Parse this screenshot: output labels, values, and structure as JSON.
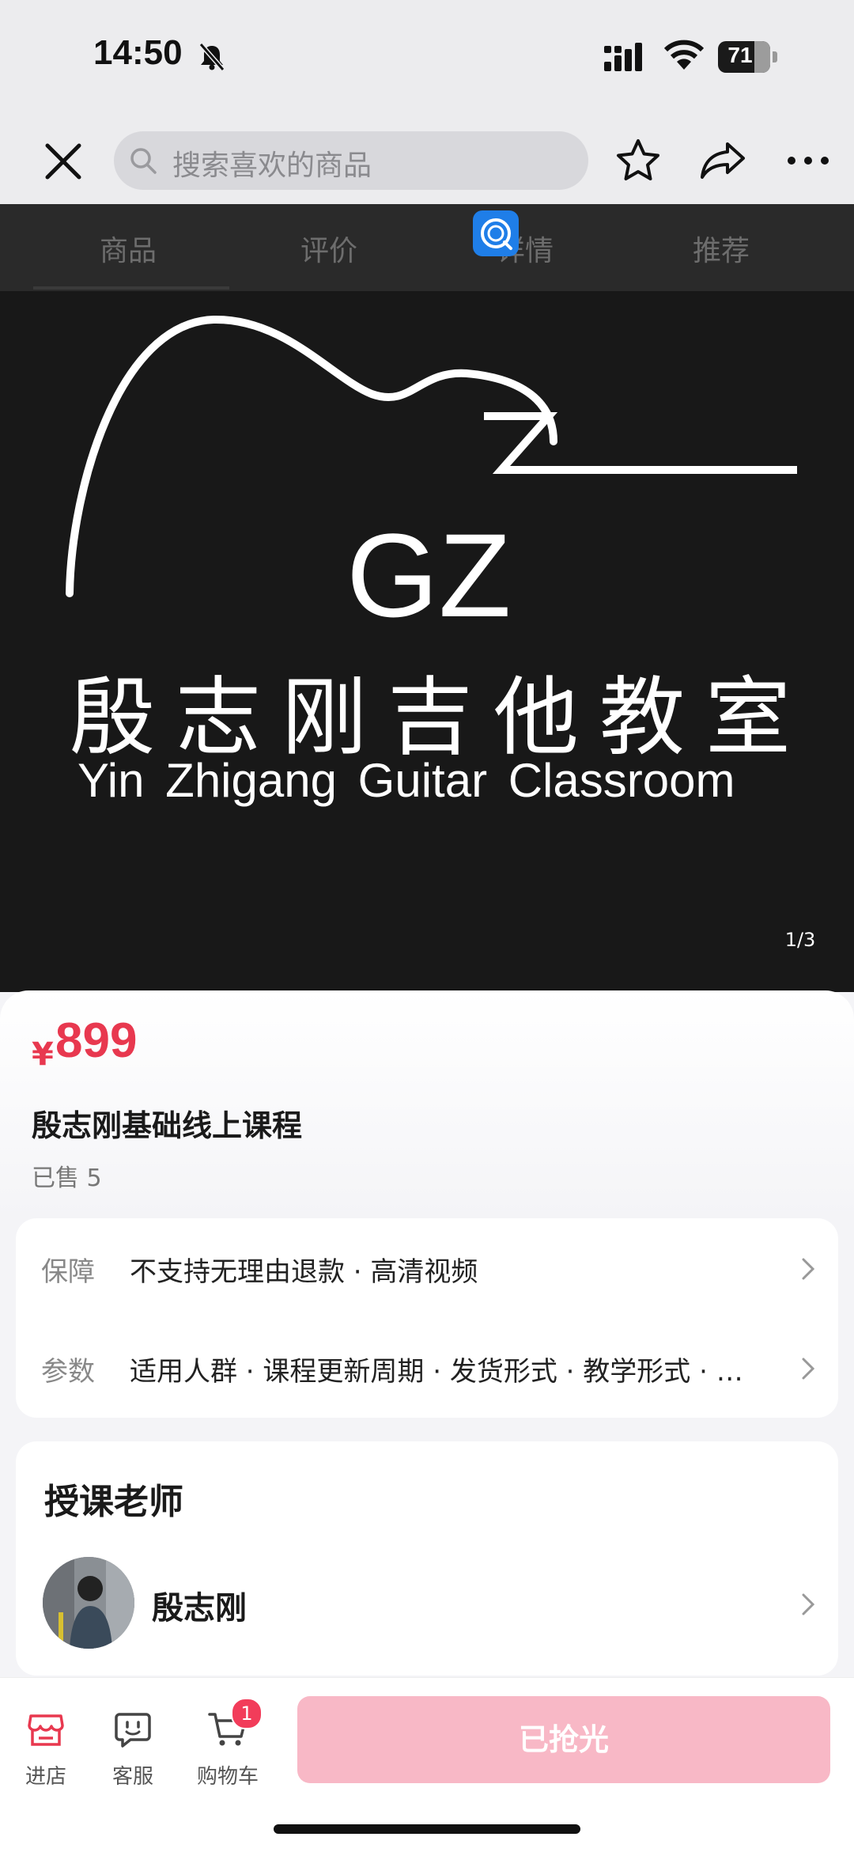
{
  "status_bar": {
    "time": "14:50",
    "battery": "71"
  },
  "top_nav": {
    "search_placeholder": "搜索喜欢的商品"
  },
  "tabs": [
    "商品",
    "评价",
    "详情",
    "推荐"
  ],
  "gallery": {
    "brand_logo_text": "GZ",
    "brand_cn": "殷志刚吉他教室",
    "brand_en": "Yin Zhigang Guitar Classroom",
    "counter": "1/3"
  },
  "product": {
    "currency": "¥",
    "price": "899",
    "title": "殷志刚基础线上课程",
    "sold": "已售 5"
  },
  "params": [
    {
      "label": "保障",
      "value": "不支持无理由退款 · 高清视频"
    },
    {
      "label": "参数",
      "value": "适用人群 · 课程更新周期 · 发货形式 · 教学形式 · …"
    }
  ],
  "teacher": {
    "title": "授课老师",
    "name": "殷志刚"
  },
  "bottom_bar": {
    "store": "进店",
    "service": "客服",
    "cart": "购物车",
    "cart_count": "1",
    "soldout": "已抢光"
  },
  "colors": {
    "price_red": "#e8384f",
    "soldout_pink": "#f8b8c6",
    "badge_red": "#f23c5a"
  }
}
